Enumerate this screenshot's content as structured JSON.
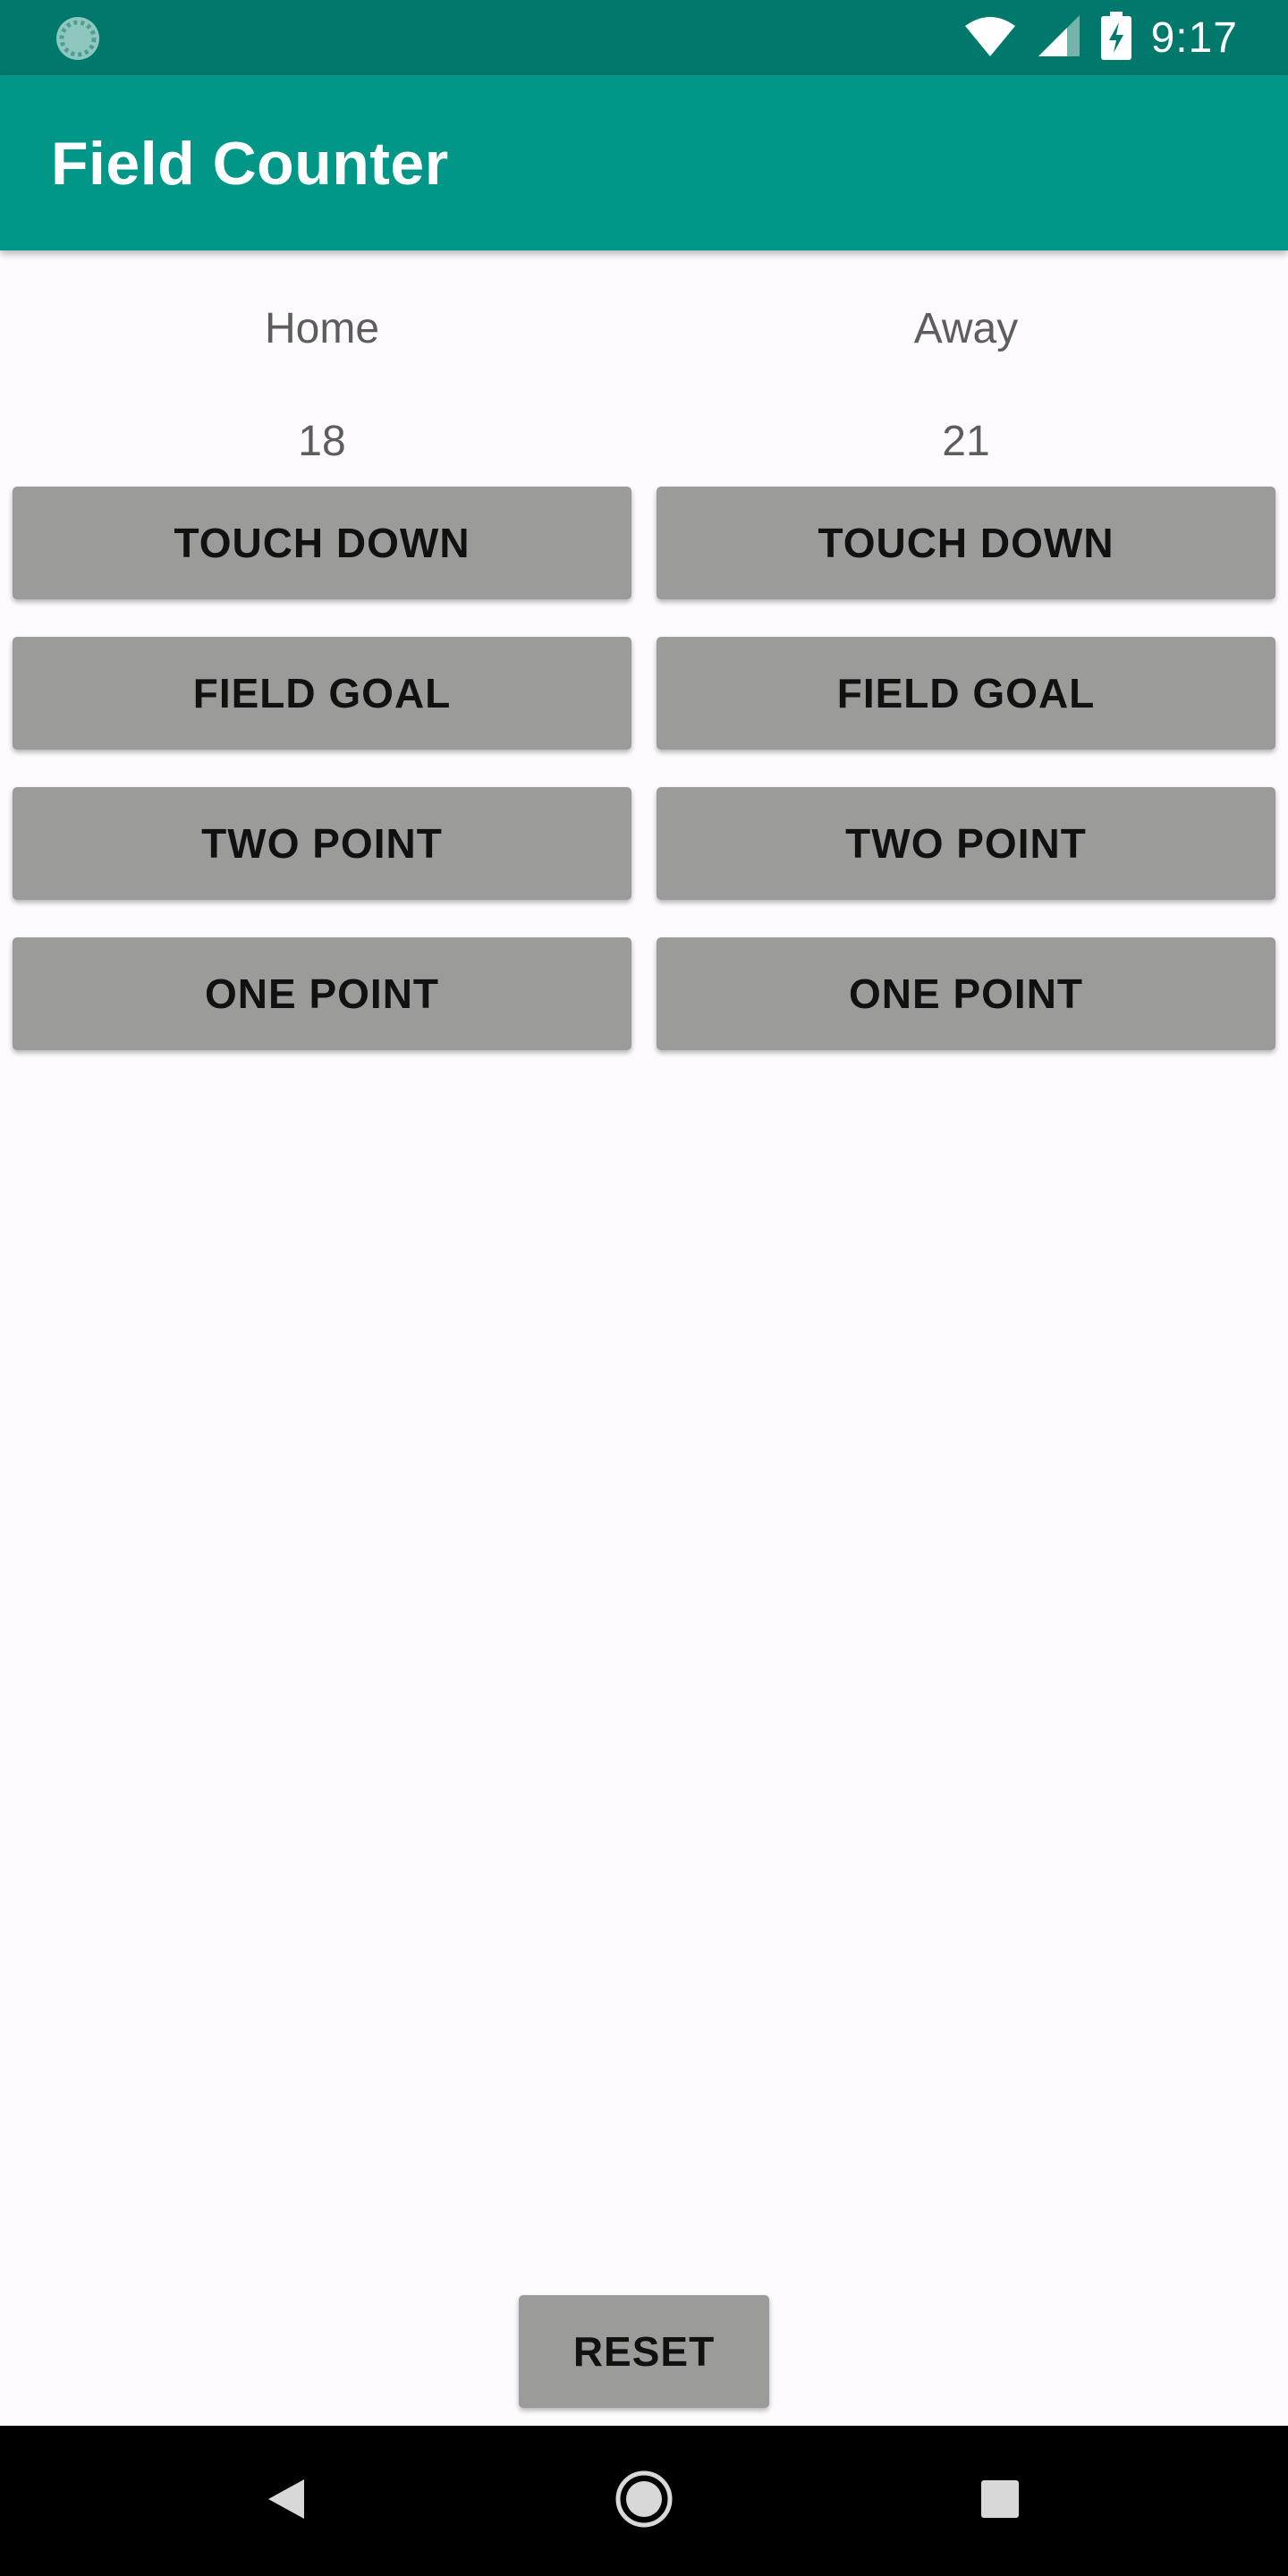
{
  "status_bar": {
    "time": "9:17",
    "icons": [
      "loading-spinner-icon",
      "wifi-icon",
      "cell-signal-icon",
      "battery-charging-icon"
    ]
  },
  "app_bar": {
    "title": "Field Counter"
  },
  "teams": {
    "home": {
      "label": "Home",
      "score": "18",
      "buttons": {
        "touch_down": "TOUCH DOWN",
        "field_goal": "FIELD GOAL",
        "two_point": "TWO POINT",
        "one_point": "ONE POINT"
      }
    },
    "away": {
      "label": "Away",
      "score": "21",
      "buttons": {
        "touch_down": "TOUCH DOWN",
        "field_goal": "FIELD GOAL",
        "two_point": "TWO POINT",
        "one_point": "ONE POINT"
      }
    }
  },
  "reset_label": "RESET",
  "nav_bar": {
    "icons": [
      "back-icon",
      "home-icon",
      "recents-icon"
    ]
  },
  "colors": {
    "status_bar": "#00786b",
    "app_bar": "#009688",
    "button": "#9b9c9a",
    "background": "#fefbfe"
  }
}
